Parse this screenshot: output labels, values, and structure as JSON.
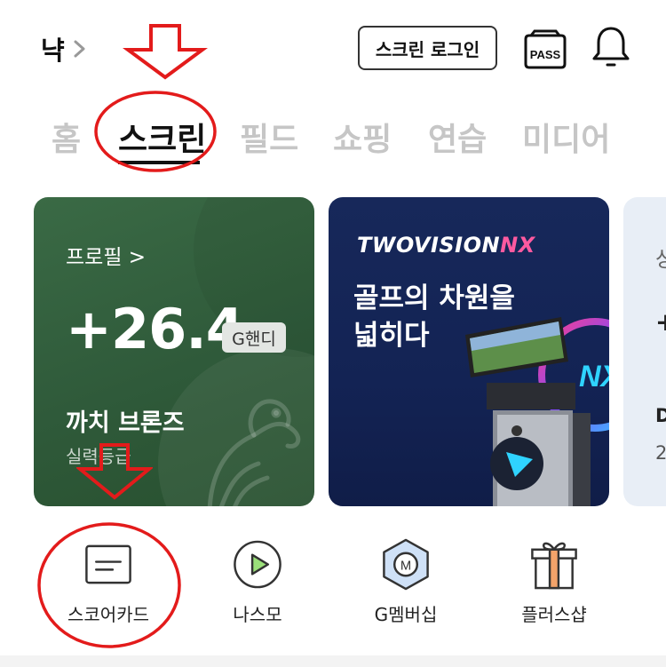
{
  "header": {
    "user_name": "냑",
    "login_button": "스크린 로그인",
    "pass_label": "PASS"
  },
  "tabs": [
    {
      "label": "홈"
    },
    {
      "label": "스크린"
    },
    {
      "label": "필드"
    },
    {
      "label": "쇼핑"
    },
    {
      "label": "연습"
    },
    {
      "label": "미디어"
    }
  ],
  "profile_card": {
    "link": "프로필 >",
    "handicap": "+26.4",
    "handicap_badge": "G핸디",
    "grade_name": "까치 브론즈",
    "grade_sub": "실력등급"
  },
  "ad_card": {
    "brand_prefix": "TWOVISION",
    "brand_suffix": "NX",
    "line1": "골프의 차원을",
    "line2": "넓히다",
    "screen_badge": "NX"
  },
  "third_card": {
    "t1": "상",
    "t2": "+",
    "t3": "D",
    "t4": "2"
  },
  "quick_menu": [
    {
      "label": "스코어카드"
    },
    {
      "label": "나스모"
    },
    {
      "label": "G멤버십"
    },
    {
      "label": "플러스샵"
    }
  ],
  "colors": {
    "annotation_red": "#e31b1b",
    "profile_green": "#2f5a3a",
    "ad_navy": "#132354"
  }
}
